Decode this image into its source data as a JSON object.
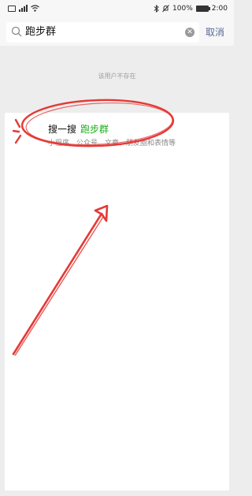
{
  "status_bar": {
    "left_icons": [
      "sim-icon",
      "signal-icon",
      "wifi-icon"
    ],
    "battery_percent": "100%",
    "time": "2:00",
    "right_icons": [
      "bluetooth-icon",
      "mute-icon",
      "battery-icon"
    ]
  },
  "search": {
    "query": "跑步群",
    "cancel_label": "取消"
  },
  "no_result": {
    "message": "该用户不存在"
  },
  "search_one": {
    "prefix": "搜一搜",
    "keyword": "跑步群",
    "subtitle": "小程序、公众号、文章、朋友圈和表情等"
  },
  "colors": {
    "accent_green": "#1aad19",
    "link_blue": "#576b95",
    "annotation_red": "#e53935"
  }
}
